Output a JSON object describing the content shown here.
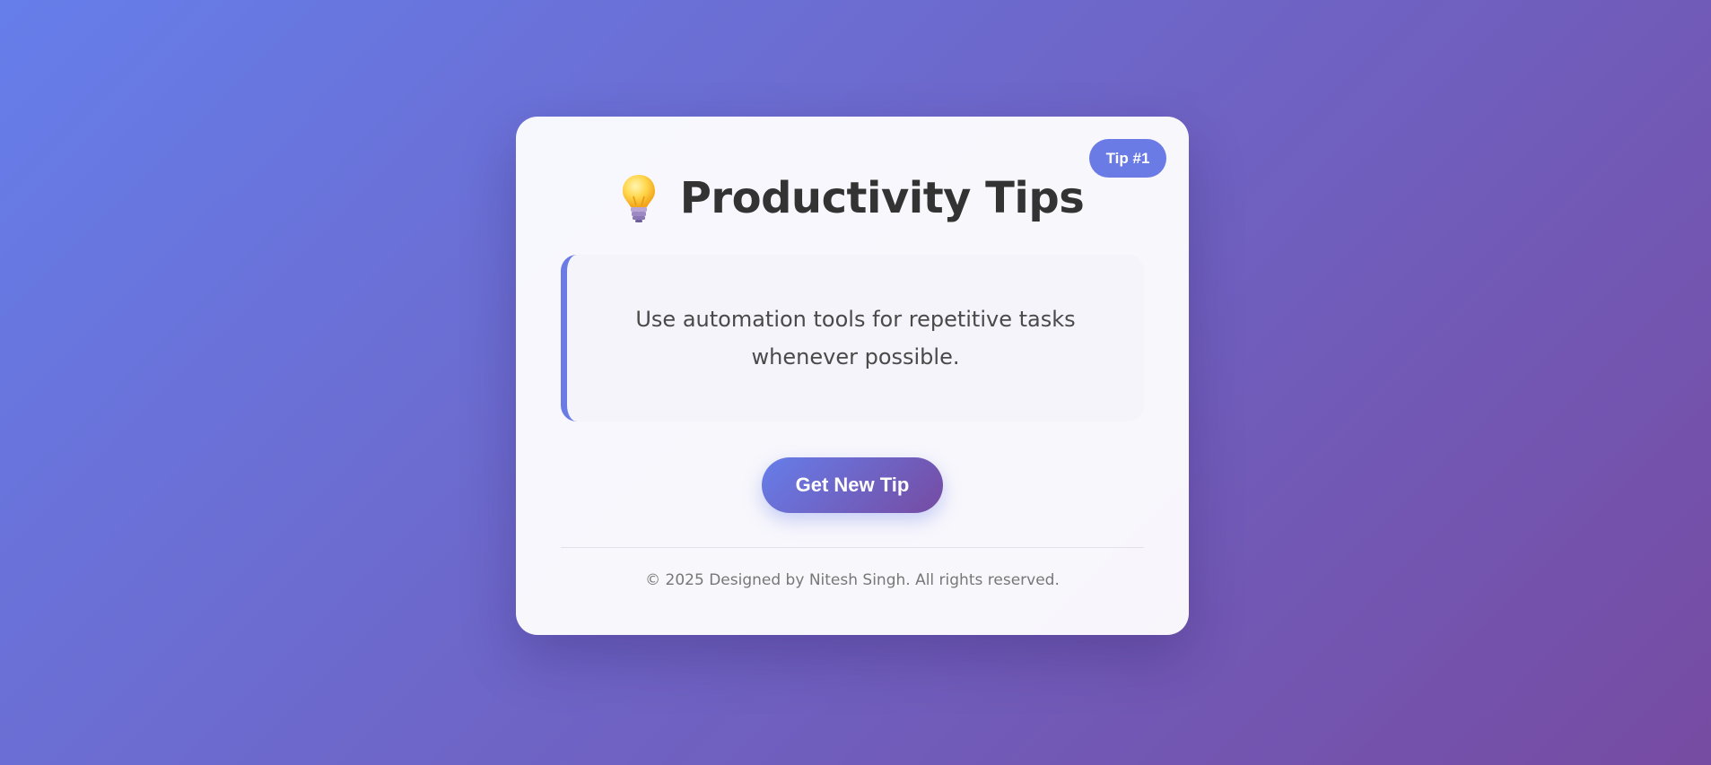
{
  "header": {
    "title": "Productivity Tips",
    "icon": "lightbulb-icon"
  },
  "badge": {
    "label": "Tip #1"
  },
  "tip": {
    "text": "Use automation tools for repetitive tasks whenever possible."
  },
  "actions": {
    "new_tip_label": "Get New Tip"
  },
  "footer": {
    "text": "© 2025 Designed by Nitesh Singh. All rights reserved."
  },
  "colors": {
    "gradient_start": "#667eea",
    "gradient_end": "#764ba2",
    "accent": "#6a7be6",
    "title": "#333333"
  }
}
